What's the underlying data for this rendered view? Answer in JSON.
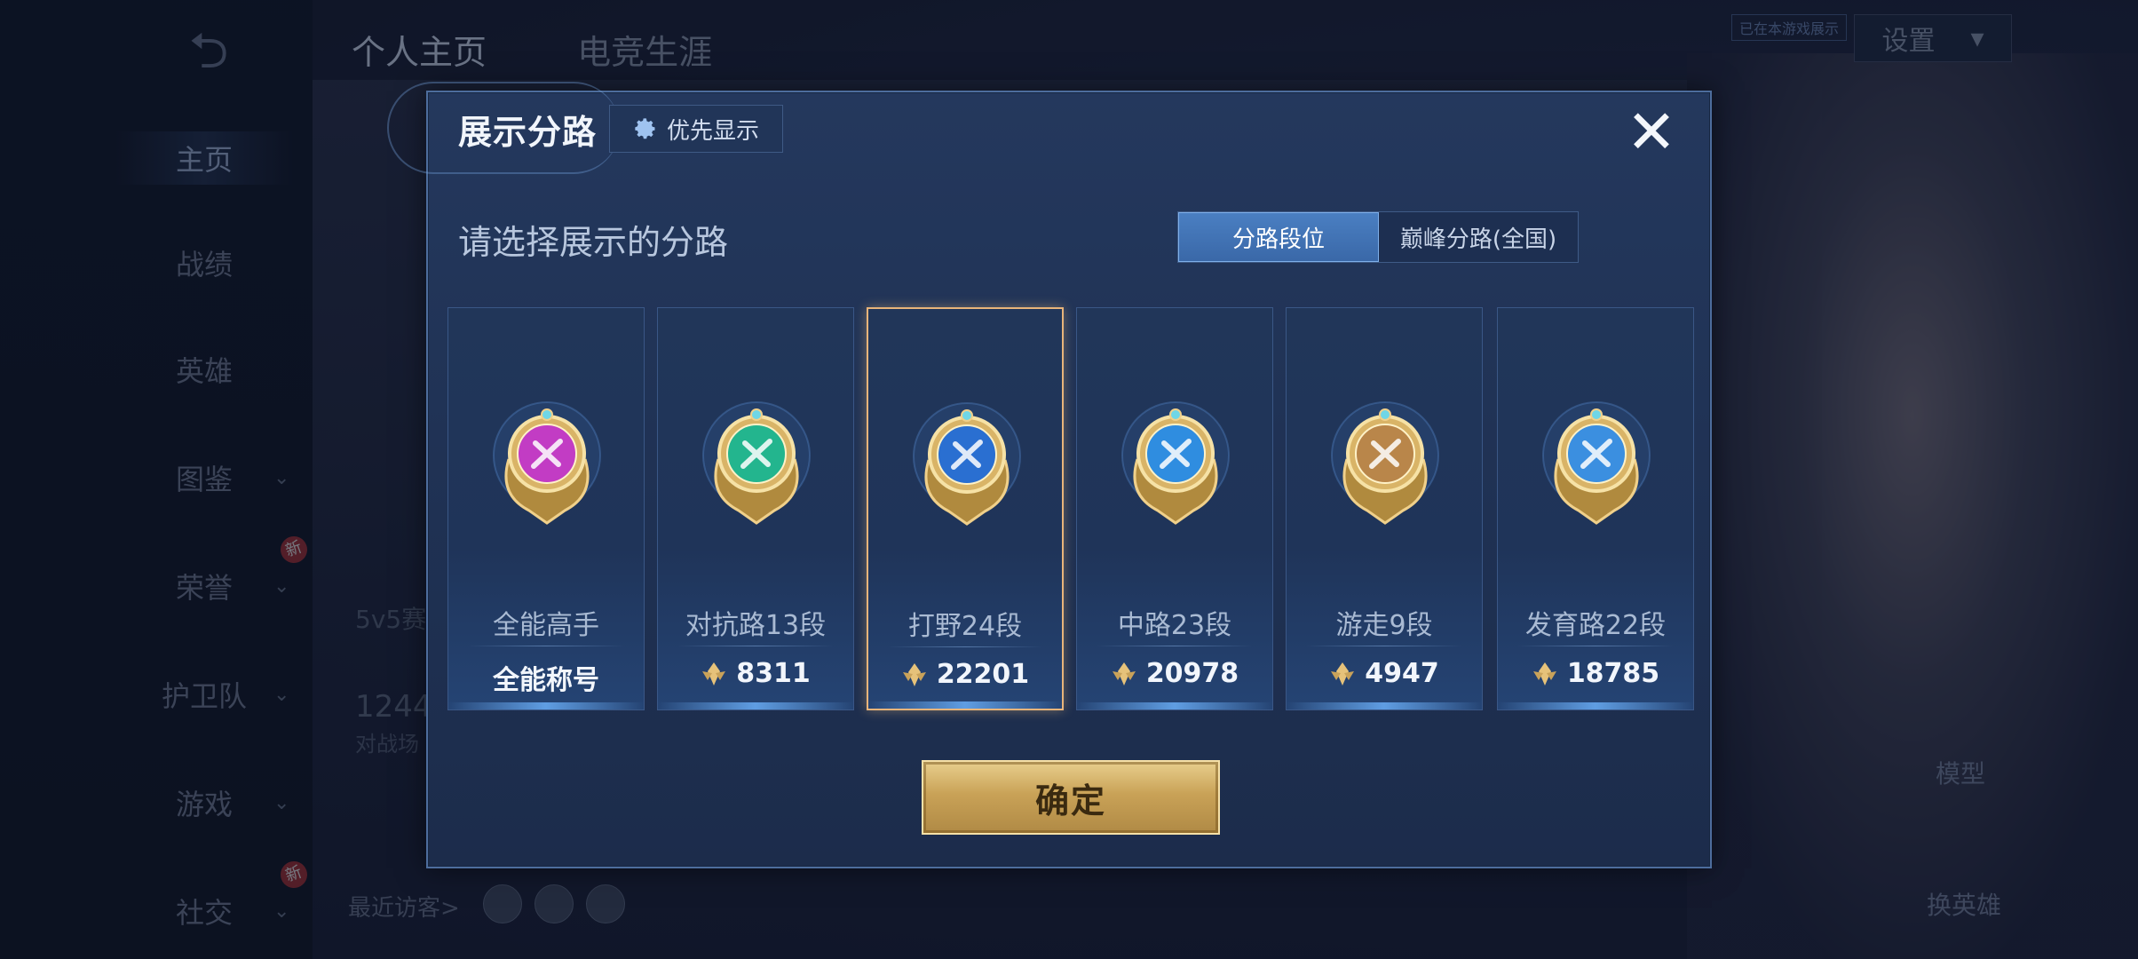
{
  "background": {
    "sidebar": [
      {
        "label": "主页",
        "active": true
      },
      {
        "label": "战绩"
      },
      {
        "label": "英雄"
      },
      {
        "label": "图鉴",
        "chevron": true
      },
      {
        "label": "荣誉",
        "chevron": true,
        "new": true
      },
      {
        "label": "护卫队",
        "chevron": true
      },
      {
        "label": "游戏",
        "chevron": true
      },
      {
        "label": "社交",
        "chevron": true,
        "new": true
      }
    ],
    "new_badge": "新",
    "tabs": [
      "个人主页",
      "电竞生涯"
    ],
    "settings_label": "设置",
    "note_label": "已在本游戏展示",
    "model_label": "模型",
    "swap_hero_label": "换英雄",
    "recent_visitors_label": "最近访客>",
    "mode_label": "5v5赛",
    "battle_count": "1244",
    "battle_label": "对战场"
  },
  "modal": {
    "title": "展示分路",
    "priority_label": "优先显示",
    "subtitle": "请选择展示的分路",
    "segments": [
      {
        "label": "分路段位",
        "active": true
      },
      {
        "label": "巅峰分路(全国)",
        "active": false
      }
    ],
    "cards": [
      {
        "name": "全能高手",
        "value": "全能称号",
        "show_icon": false,
        "color": "#c23cc4",
        "selected": false
      },
      {
        "name": "对抗路13段",
        "value": "8311",
        "show_icon": true,
        "color": "#23b58e",
        "selected": false
      },
      {
        "name": "打野24段",
        "value": "22201",
        "show_icon": true,
        "color": "#2a6fd1",
        "selected": true
      },
      {
        "name": "中路23段",
        "value": "20978",
        "show_icon": true,
        "color": "#2f8de0",
        "selected": false
      },
      {
        "name": "游走9段",
        "value": "4947",
        "show_icon": true,
        "color": "#b9864a",
        "selected": false
      },
      {
        "name": "发育路22段",
        "value": "18785",
        "show_icon": true,
        "color": "#3b8fe0",
        "selected": false
      }
    ],
    "confirm_label": "确定"
  }
}
